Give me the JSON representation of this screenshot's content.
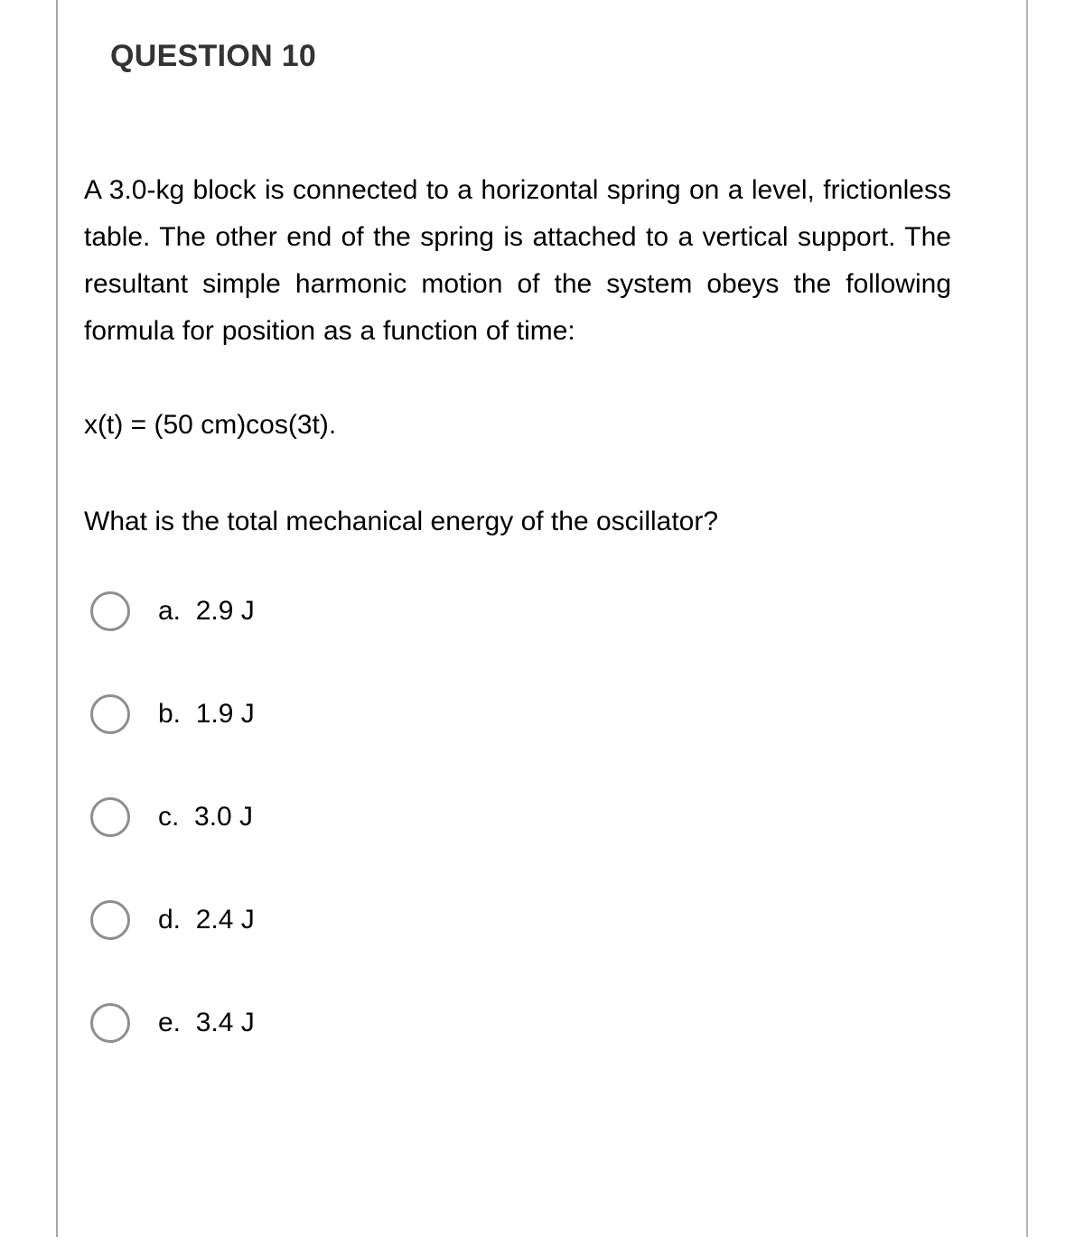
{
  "page": {
    "background_color": "#ffffff",
    "border_color": "#a8a8a8"
  },
  "question": {
    "title": "QUESTION 10",
    "title_color": "#333333",
    "body": "A 3.0-kg block is connected to a horizontal spring on a level, frictionless table. The other end of the spring is attached to a vertical support. The resultant simple harmonic motion of the system obeys the following formula for position as a function of time:",
    "formula": "x(t) = (50 cm)cos(3t).",
    "prompt": "What is the total mechanical energy of the oscillator?"
  },
  "options": [
    {
      "id": "a",
      "label": "a.  2.9 J",
      "selected": false
    },
    {
      "id": "b",
      "label": "b.  1.9 J",
      "selected": false
    },
    {
      "id": "c",
      "label": "c.  3.0 J",
      "selected": false
    },
    {
      "id": "d",
      "label": "d.  2.4 J",
      "selected": false
    },
    {
      "id": "e",
      "label": "e.  3.4 J",
      "selected": false
    }
  ],
  "scrollbar": {
    "thumb_color": "#f1f1f1"
  }
}
